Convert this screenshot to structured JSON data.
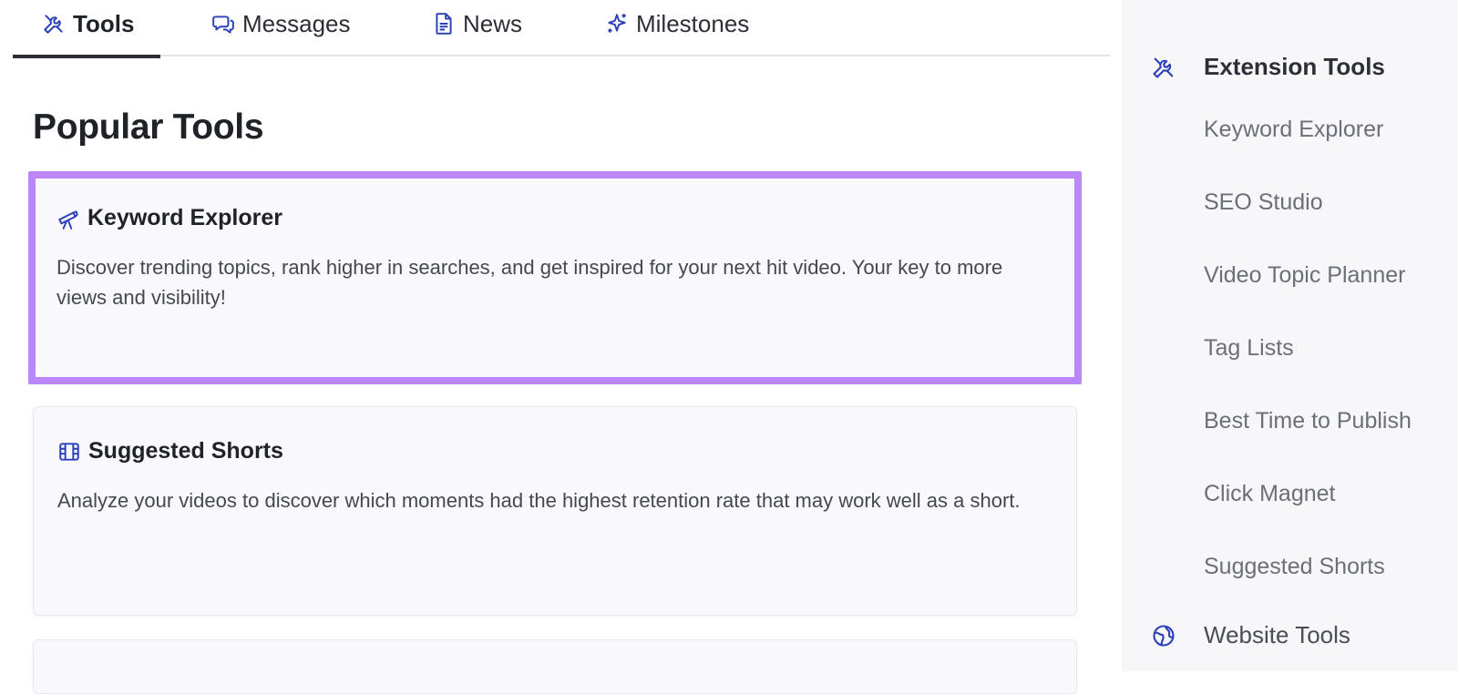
{
  "tabs": [
    {
      "label": "Tools",
      "icon": "tools-icon",
      "active": true
    },
    {
      "label": "Messages",
      "icon": "messages-icon"
    },
    {
      "label": "News",
      "icon": "document-icon"
    },
    {
      "label": "Milestones",
      "icon": "sparkles-icon"
    }
  ],
  "main": {
    "title": "Popular Tools",
    "cards": [
      {
        "title": "Keyword Explorer",
        "icon": "telescope-icon",
        "description": "Discover trending topics, rank higher in searches, and get inspired for your next hit video. Your key to more views and visibility!"
      },
      {
        "title": "Suggested Shorts",
        "icon": "film-icon",
        "description": "Analyze your videos to discover which moments had the highest retention rate that may work well as a short."
      }
    ]
  },
  "sidebar": {
    "section_extension": "Extension Tools",
    "items": [
      "Keyword Explorer",
      "SEO Studio",
      "Video Topic Planner",
      "Tag Lists",
      "Best Time to Publish",
      "Click Magnet",
      "Suggested Shorts"
    ],
    "section_website": "Website Tools"
  },
  "colors": {
    "icon_blue": "#2a3fb8",
    "highlight": "#bb86f7",
    "card_bg": "#f9f9fd"
  }
}
